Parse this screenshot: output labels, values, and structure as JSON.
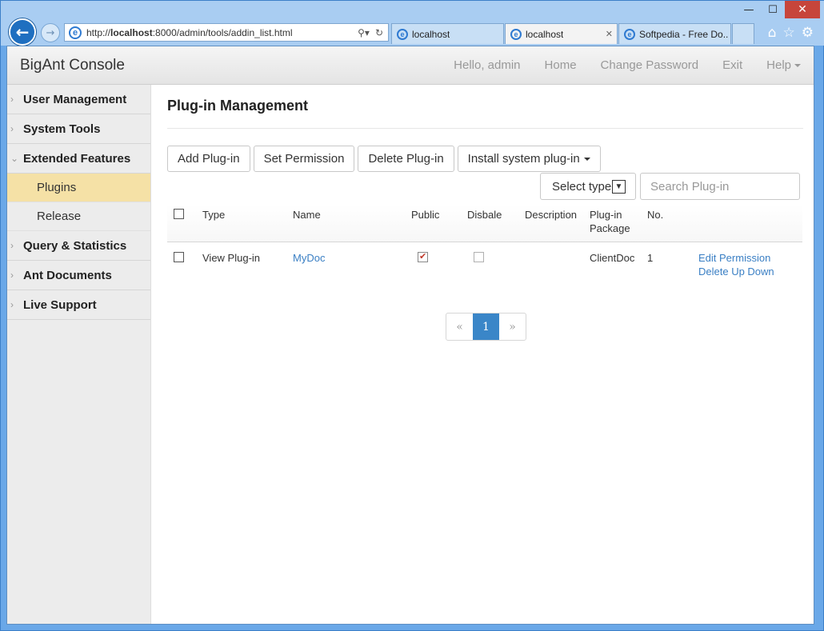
{
  "browser": {
    "url_prefix": "http://",
    "url_host": "localhost",
    "url_rest": ":8000/admin/tools/addin_list.html",
    "tabs": [
      {
        "label": "localhost",
        "active": false
      },
      {
        "label": "localhost",
        "active": true
      },
      {
        "label": "Softpedia - Free Do...",
        "active": false
      }
    ]
  },
  "navbar": {
    "brand": "BigAnt Console",
    "greeting": "Hello, admin",
    "home": "Home",
    "change_password": "Change Password",
    "exit": "Exit",
    "help": "Help"
  },
  "sidebar": {
    "user_management": "User Management",
    "system_tools": "System Tools",
    "extended_features": "Extended Features",
    "plugins": "Plugins",
    "release": "Release",
    "query_statistics": "Query & Statistics",
    "ant_documents": "Ant Documents",
    "live_support": "Live Support"
  },
  "main": {
    "title": "Plug-in Management",
    "buttons": {
      "add": "Add Plug-in",
      "set_permission": "Set Permission",
      "delete": "Delete Plug-in",
      "install": "Install system plug-in"
    },
    "filter": {
      "select_type": "Select type",
      "search_placeholder": "Search Plug-in"
    },
    "columns": {
      "type": "Type",
      "name": "Name",
      "public": "Public",
      "disable": "Disbale",
      "description": "Description",
      "package_line1": "Plug-in",
      "package_line2": "Package",
      "no": "No."
    },
    "rows": [
      {
        "type": "View Plug-in",
        "name": "MyDoc",
        "public": true,
        "disabled": false,
        "description": "",
        "package": "ClientDoc",
        "no": "1",
        "op1": "Edit Permission",
        "op2": "Delete Up Down"
      }
    ],
    "pagination": {
      "prev": "«",
      "current": "1",
      "next": "»"
    }
  },
  "colors": {
    "accent": "#3a86c8",
    "active_sidebar": "#f5e1a6",
    "link": "#3a7fc4"
  }
}
